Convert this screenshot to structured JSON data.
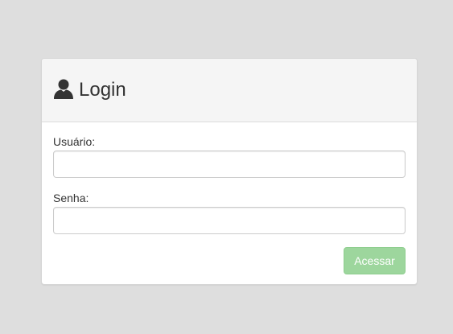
{
  "page": {
    "background": "#dedede"
  },
  "panel": {
    "title": "Login",
    "title_icon": "user-icon",
    "heading_background": "#f5f5f5"
  },
  "form": {
    "username": {
      "label": "Usuário:",
      "value": "",
      "placeholder": ""
    },
    "password": {
      "label": "Senha:",
      "value": "",
      "placeholder": ""
    },
    "submit": {
      "label": "Acessar",
      "color": "#9dd69d",
      "state": "disabled"
    }
  }
}
